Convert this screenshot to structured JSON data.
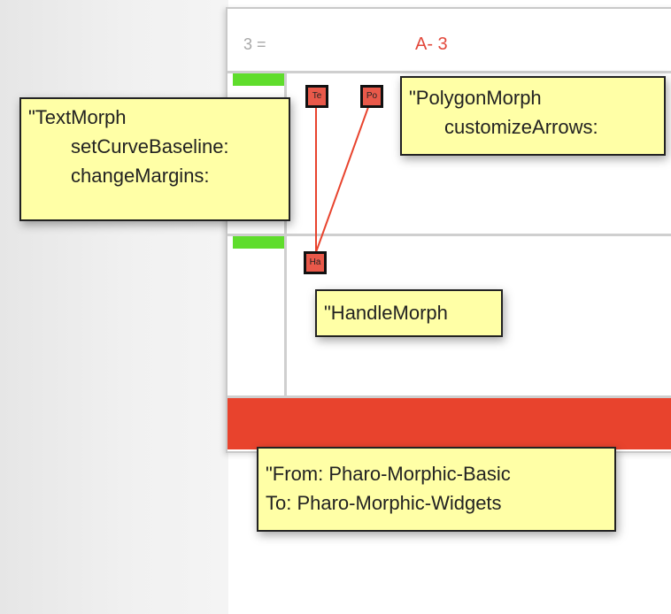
{
  "matrix": {
    "row_label": "3 =",
    "column_label": "A- 3"
  },
  "nodes": {
    "text_morph": "Te",
    "polygon_morph": "Po",
    "handle_morph": "Ha"
  },
  "tooltips": {
    "text_morph": {
      "line1": "\"TextMorph",
      "line2": "setCurveBaseline:",
      "line3": "changeMargins:"
    },
    "polygon_morph": {
      "line1": "\"PolygonMorph",
      "line2": "customizeArrows:"
    },
    "handle_morph": {
      "line1": "\"HandleMorph"
    },
    "dependency": {
      "line1": "\"From: Pharo-Morphic-Basic",
      "line2": "To: Pharo-Morphic-Widgets"
    }
  },
  "colors": {
    "accent_red": "#e8432d",
    "node_red": "#e9594a",
    "tooltip_yellow": "#ffffa6",
    "marker_green": "#5fdd2c"
  }
}
